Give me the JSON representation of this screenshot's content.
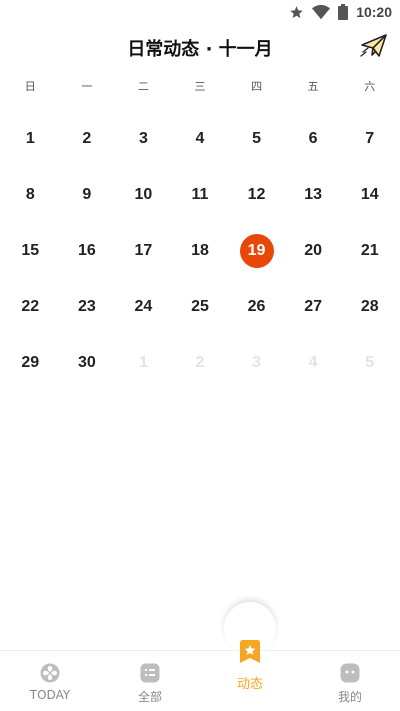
{
  "status_bar": {
    "time": "10:20",
    "icons": [
      "star-icon",
      "wifi-icon",
      "battery-icon"
    ]
  },
  "header": {
    "title": "日常动态 · 十一月",
    "action_icon": "paper-plane-icon"
  },
  "weekdays": [
    "日",
    "一",
    "二",
    "三",
    "四",
    "五",
    "六"
  ],
  "calendar": {
    "days": [
      {
        "label": "1",
        "muted": false,
        "today": false
      },
      {
        "label": "2",
        "muted": false,
        "today": false
      },
      {
        "label": "3",
        "muted": false,
        "today": false
      },
      {
        "label": "4",
        "muted": false,
        "today": false
      },
      {
        "label": "5",
        "muted": false,
        "today": false
      },
      {
        "label": "6",
        "muted": false,
        "today": false
      },
      {
        "label": "7",
        "muted": false,
        "today": false
      },
      {
        "label": "8",
        "muted": false,
        "today": false
      },
      {
        "label": "9",
        "muted": false,
        "today": false
      },
      {
        "label": "10",
        "muted": false,
        "today": false
      },
      {
        "label": "11",
        "muted": false,
        "today": false
      },
      {
        "label": "12",
        "muted": false,
        "today": false
      },
      {
        "label": "13",
        "muted": false,
        "today": false
      },
      {
        "label": "14",
        "muted": false,
        "today": false
      },
      {
        "label": "15",
        "muted": false,
        "today": false
      },
      {
        "label": "16",
        "muted": false,
        "today": false
      },
      {
        "label": "17",
        "muted": false,
        "today": false
      },
      {
        "label": "18",
        "muted": false,
        "today": false
      },
      {
        "label": "19",
        "muted": false,
        "today": true
      },
      {
        "label": "20",
        "muted": false,
        "today": false
      },
      {
        "label": "21",
        "muted": false,
        "today": false
      },
      {
        "label": "22",
        "muted": false,
        "today": false
      },
      {
        "label": "23",
        "muted": false,
        "today": false
      },
      {
        "label": "24",
        "muted": false,
        "today": false
      },
      {
        "label": "25",
        "muted": false,
        "today": false
      },
      {
        "label": "26",
        "muted": false,
        "today": false
      },
      {
        "label": "27",
        "muted": false,
        "today": false
      },
      {
        "label": "28",
        "muted": false,
        "today": false
      },
      {
        "label": "29",
        "muted": false,
        "today": false
      },
      {
        "label": "30",
        "muted": false,
        "today": false
      },
      {
        "label": "1",
        "muted": true,
        "today": false
      },
      {
        "label": "2",
        "muted": true,
        "today": false
      },
      {
        "label": "3",
        "muted": true,
        "today": false
      },
      {
        "label": "4",
        "muted": true,
        "today": false
      },
      {
        "label": "5",
        "muted": true,
        "today": false
      }
    ],
    "highlight_color": "#e8470a"
  },
  "tabs": [
    {
      "label": "TODAY",
      "icon": "clover-icon",
      "active": false
    },
    {
      "label": "全部",
      "icon": "list-icon",
      "active": false
    },
    {
      "label": "动态",
      "icon": "star-bookmark-icon",
      "active": true
    },
    {
      "label": "我的",
      "icon": "face-icon",
      "active": false
    }
  ],
  "colors": {
    "accent": "#f5a623",
    "today": "#e8470a",
    "inactive_tab": "#888888"
  }
}
